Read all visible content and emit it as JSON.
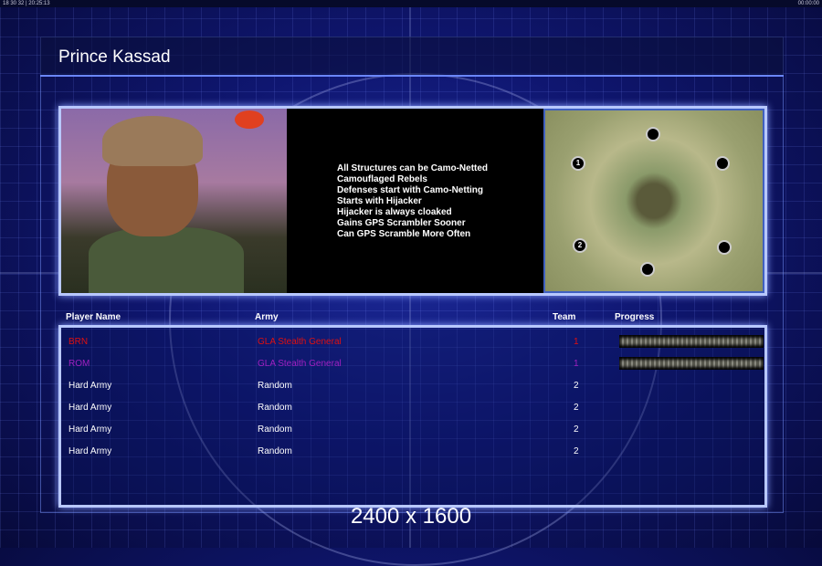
{
  "status_bar": {
    "left": "18 30 32 | 20:25:13",
    "right": "00:00:00"
  },
  "title": "Prince Kassad",
  "traits": [
    "All Structures can be Camo-Netted",
    "Camouflaged Rebels",
    "Defenses start with Camo-Netting",
    "Starts with Hijacker",
    "Hijacker is always cloaked",
    "Gains GPS Scrambler Sooner",
    "Can GPS Scramble More Often"
  ],
  "map": {
    "start_positions": [
      "1",
      "2"
    ]
  },
  "table": {
    "headers": {
      "player": "Player Name",
      "army": "Army",
      "team": "Team",
      "progress": "Progress"
    },
    "rows": [
      {
        "player": "BRN",
        "army": "GLA Stealth General",
        "team": "1",
        "color": "#e01010",
        "progress": 100
      },
      {
        "player": "ROM",
        "army": "GLA Stealth General",
        "team": "1",
        "color": "#a020c0",
        "progress": 100
      },
      {
        "player": "Hard Army",
        "army": "Random",
        "team": "2",
        "color": "#ffffff"
      },
      {
        "player": "Hard Army",
        "army": "Random",
        "team": "2",
        "color": "#ffffff"
      },
      {
        "player": "Hard Army",
        "army": "Random",
        "team": "2",
        "color": "#ffffff"
      },
      {
        "player": "Hard Army",
        "army": "Random",
        "team": "2",
        "color": "#ffffff"
      }
    ]
  },
  "resolution": "2400 x 1600"
}
